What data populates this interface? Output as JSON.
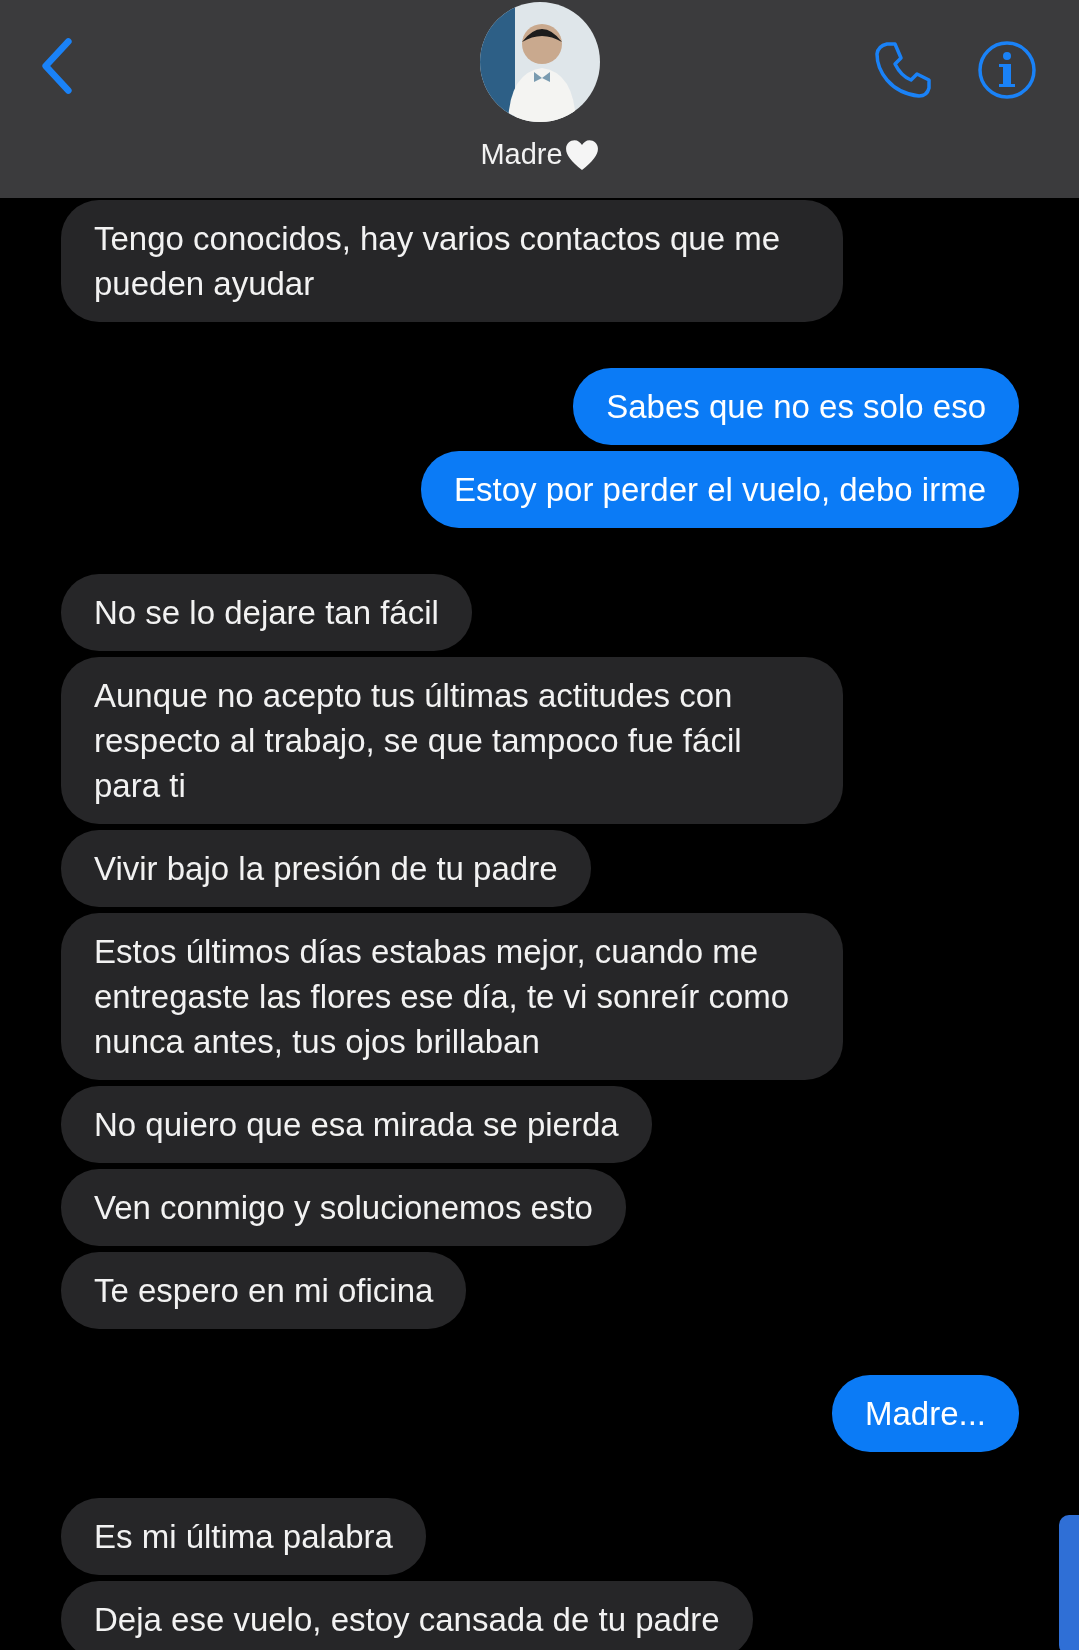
{
  "header": {
    "contact_name": "Madre"
  },
  "messages": [
    {
      "kind": "received",
      "text": "Tengo conocidos, hay varios contactos que me pueden ayudar"
    },
    {
      "kind": "sent",
      "text": "Sabes que no es solo eso"
    },
    {
      "kind": "sent",
      "text": "Estoy por perder el vuelo, debo irme"
    },
    {
      "kind": "received",
      "text": "No se lo dejare tan fácil"
    },
    {
      "kind": "received",
      "text": "Aunque no acepto tus últimas actitudes con respecto al trabajo, se que tampoco fue fácil para ti"
    },
    {
      "kind": "received",
      "text": "Vivir bajo la presión de tu padre"
    },
    {
      "kind": "received",
      "text": "Estos últimos días estabas mejor, cuando me entregaste las flores ese día, te vi sonreír como nunca antes, tus ojos brillaban"
    },
    {
      "kind": "received",
      "text": "No quiero que esa mirada se pierda"
    },
    {
      "kind": "received",
      "text": "Ven conmigo y solucionemos esto"
    },
    {
      "kind": "received",
      "text": "Te espero en mi oficina"
    },
    {
      "kind": "sent",
      "text": "Madre..."
    },
    {
      "kind": "received",
      "text": "Es mi última palabra"
    },
    {
      "kind": "received",
      "text": "Deja ese vuelo, estoy cansada de tu padre"
    }
  ]
}
